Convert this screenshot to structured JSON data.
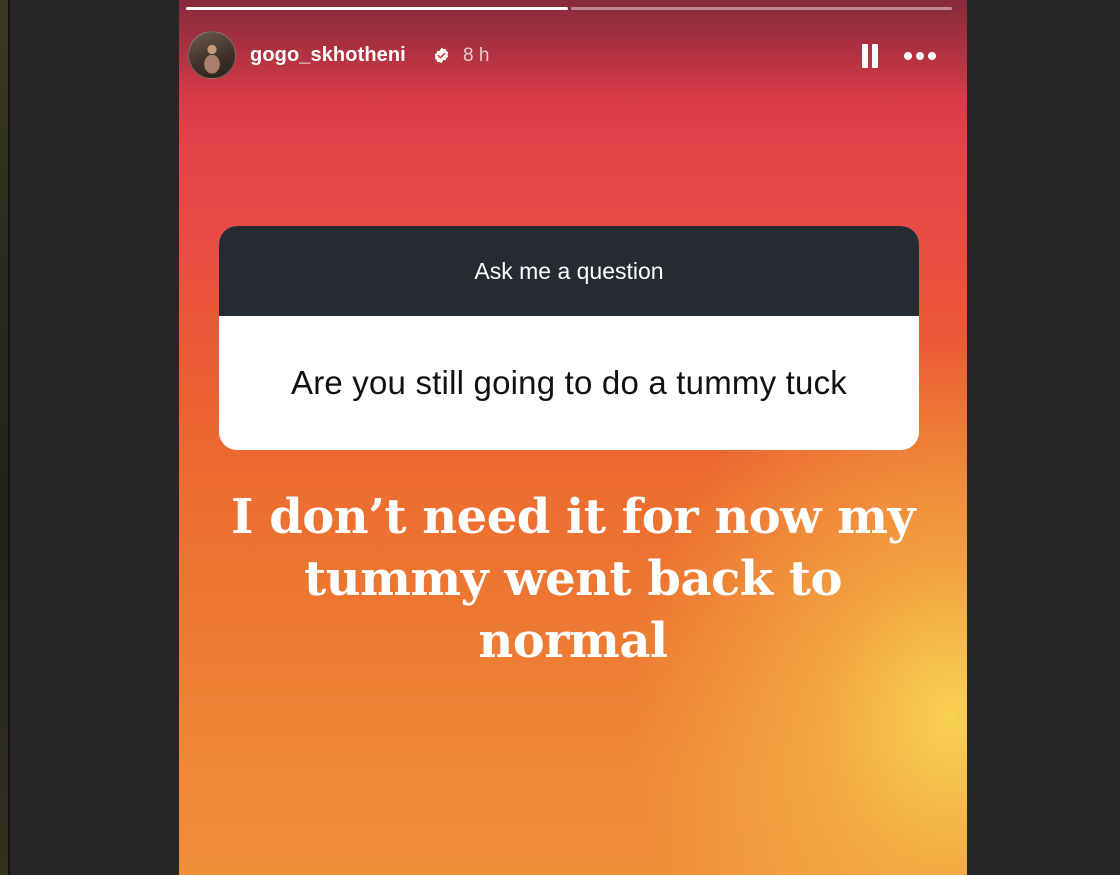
{
  "story": {
    "username": "gogo_skhotheni",
    "verified": true,
    "time_ago": "8 h",
    "progress": {
      "segments": 2,
      "completed": 1
    },
    "controls": {
      "pause_icon": "pause-icon",
      "more_icon": "more-options-icon"
    },
    "question_box": {
      "prompt": "Ask me a question",
      "question": "Are you still going to do a tummy tuck"
    },
    "answer_lines": [
      "I don’t need it for now my",
      "tummy went back to",
      "normal"
    ]
  },
  "colors": {
    "page_bg": "#262626",
    "question_header_bg": "#262a31",
    "gradient_top": "#852a3c",
    "gradient_mid": "#e6424a",
    "gradient_bottom": "#f08e3a",
    "gradient_highlight": "#f9d555"
  }
}
